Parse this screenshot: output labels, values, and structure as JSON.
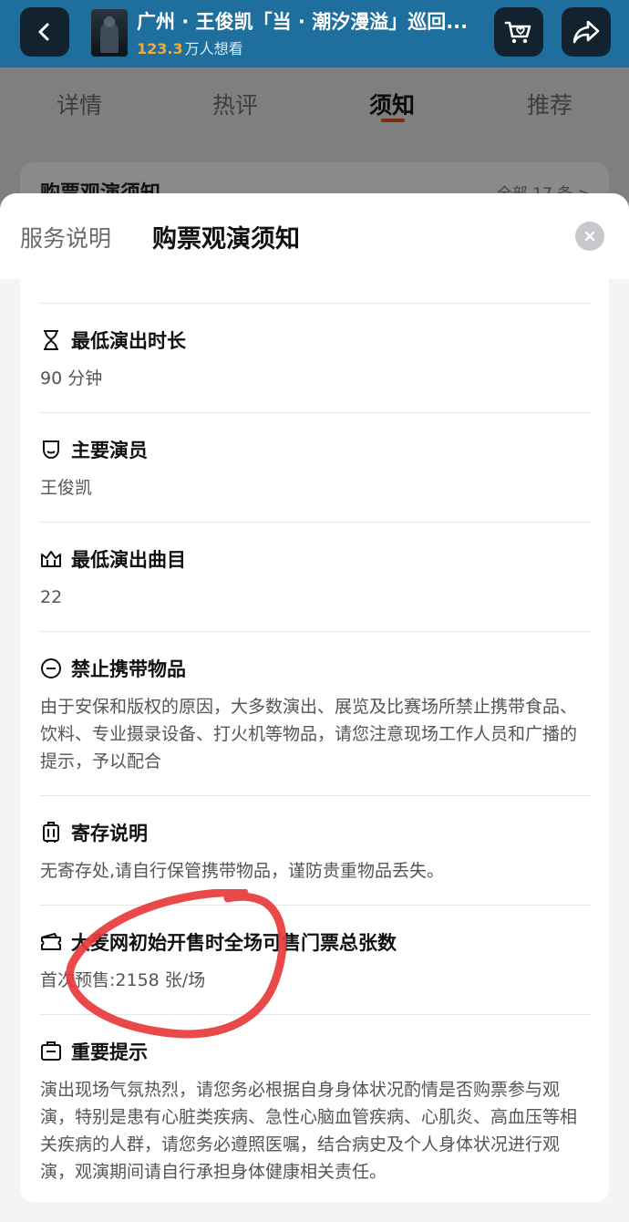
{
  "header": {
    "title": "广州 · 王俊凯「当 · 潮汐漫溢」巡回...",
    "want_count": "123.3",
    "want_suffix": "万人想看",
    "icons": [
      "back-arrow-icon",
      "cart-heart-icon",
      "share-icon"
    ],
    "bar_color": "#1f6f9e"
  },
  "tabs": [
    "详情",
    "热评",
    "须知",
    "推荐"
  ],
  "active_tab": "须知",
  "bg_card": {
    "title": "购票观演须知",
    "more": "全部 17 条 >"
  },
  "sheet": {
    "tab_service": "服务说明",
    "tab_notice": "购票观演须知"
  },
  "sections": [
    {
      "icon": "hourglass-icon",
      "title": "最低演出时长",
      "body": "90 分钟"
    },
    {
      "icon": "mask-icon",
      "title": "主要演员",
      "body": "王俊凯"
    },
    {
      "icon": "crown-icon",
      "title": "最低演出曲目",
      "body": "22"
    },
    {
      "icon": "no-entry-icon",
      "title": "禁止携带物品",
      "body": "由于安保和版权的原因，大多数演出、展览及比赛场所禁止携带食品、饮料、专业摄录设备、打火机等物品，请您注意现场工作人员和广播的提示，予以配合"
    },
    {
      "icon": "luggage-icon",
      "title": "寄存说明",
      "body": "无寄存处,请自行保管携带物品，谨防贵重物品丢失。"
    },
    {
      "icon": "ticket-icon",
      "title": "大麦网初始开售时全场可售门票总张数",
      "body": "首次预售:2158 张/场"
    },
    {
      "icon": "notice-icon",
      "title": "重要提示",
      "body": "演出现场气氛热烈，请您务必根据自身身体状况酌情是否购票参与观演，特别是患有心脏类疾病、急性心脑血管疾病、心肌炎、高血压等相关疾病的人群，请您务必遵照医嘱，结合病史及个人身体状况进行观演，观演期间请自行承担身体健康相关责任。"
    }
  ],
  "annotation_color": "#e8393a"
}
